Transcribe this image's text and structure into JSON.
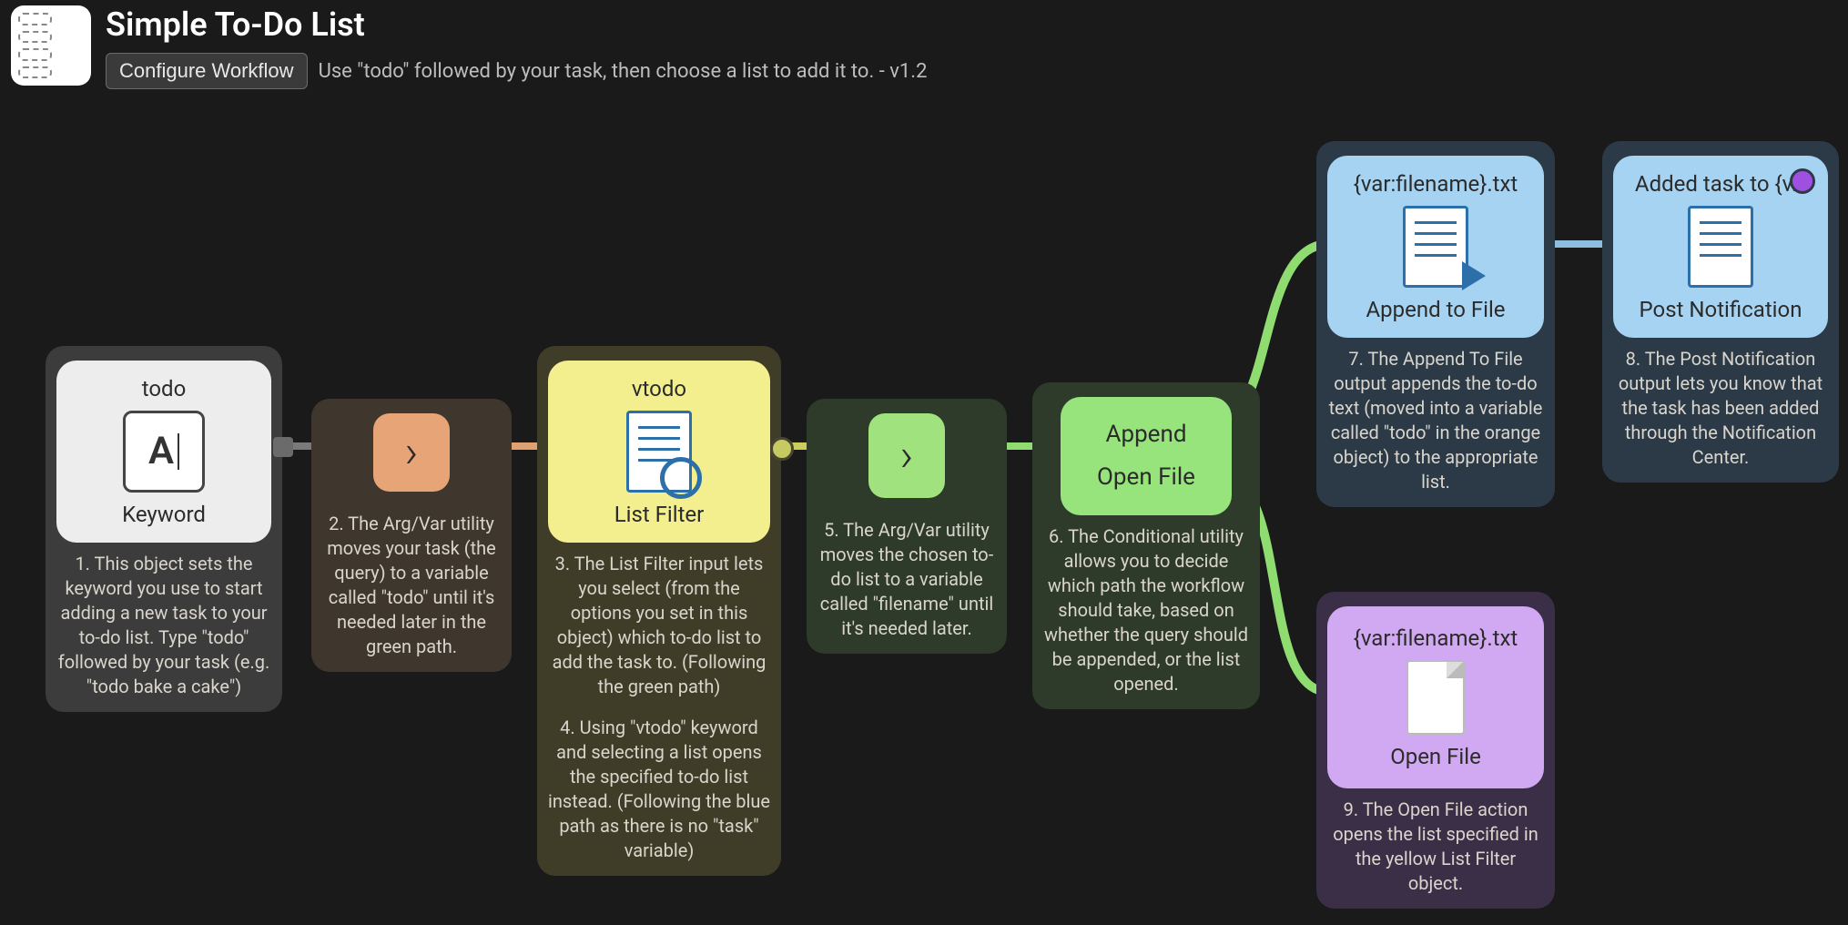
{
  "header": {
    "title": "Simple To-Do List",
    "configure_label": "Configure Workflow",
    "description": "Use \"todo\" followed by your task, then choose a list to add it to. - v1.2"
  },
  "nodes": {
    "keyword": {
      "title": "todo",
      "icon_text": "A",
      "caption": "Keyword",
      "note": "1. This object sets the keyword you use to start adding a new task to your to-do list. Type \"todo\" followed by your task (e.g. \"todo bake a cake\")"
    },
    "argvar1": {
      "note": "2. The Arg/Var utility moves your task (the query) to a variable called \"todo\" until it's needed later in the green path."
    },
    "listfilter": {
      "title": "vtodo",
      "caption": "List Filter",
      "note3": "3. The List Filter input lets you select (from the options you set in this object) which to-do list to add the task to. (Following the green path)",
      "note4": "4. Using \"vtodo\" keyword and selecting a list opens the specified to-do list instead. (Following the blue path as there is no \"task\" variable)"
    },
    "argvar2": {
      "note": "5. The Arg/Var utility moves the chosen to-do list to a variable called \"filename\" until it's needed later."
    },
    "conditional": {
      "line1": "Append",
      "line2": "Open File",
      "note": "6. The Conditional utility allows you to decide which path the workflow should take, based on whether the query should be appended, or the list opened."
    },
    "append": {
      "title": "{var:filename}.txt",
      "caption": "Append to File",
      "note": "7. The Append To File output appends the to-do text (moved into a variable called \"todo\" in the orange object) to the appropriate list."
    },
    "post": {
      "title": "Added task to {v…",
      "caption": "Post Notification",
      "note": "8. The Post Notification output lets you know that the task has been added through the Notification Center."
    },
    "open": {
      "title": "{var:filename}.txt",
      "caption": "Open File",
      "note": "9. The Open File action opens the list specified in the yellow List Filter object."
    }
  }
}
